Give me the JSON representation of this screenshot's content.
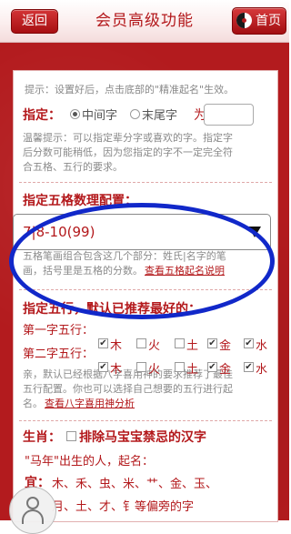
{
  "header": {
    "back": "返回",
    "title": "会员高级功能",
    "home": "首页"
  },
  "tip": "提示：设置好后，点击底部的\"精准起名\"生效。",
  "designate": {
    "label": "指定：",
    "opt_mid": "中间字",
    "opt_end": "末尾字",
    "selected": "中间字",
    "as_word": "为",
    "value": "",
    "hint_lines": [
      "温馨提示：可以指定辈分字或喜欢的字。指定字",
      "后分数可能稍低，因为您指定的字不一定完全符",
      "合五格、五行的要求。"
    ]
  },
  "wuge": {
    "heading": "指定五格数理配置：",
    "selected": "7|8-10(99)",
    "hint_lines": [
      "五格笔画组合包含这几个部分：姓氏|名字的笔",
      "画，括号里是五格的分数。"
    ],
    "link": "查看五格起名说明"
  },
  "wuxing": {
    "heading": "指定五行，默认已推荐最好的：",
    "rows": [
      {
        "label": "第一字五行：",
        "items": [
          {
            "name": "木",
            "checked": true
          },
          {
            "name": "火",
            "checked": false
          },
          {
            "name": "土",
            "checked": false
          },
          {
            "name": "金",
            "checked": true
          },
          {
            "name": "水",
            "checked": true
          }
        ]
      },
      {
        "label": "第二字五行：",
        "items": [
          {
            "name": "木",
            "checked": true
          },
          {
            "name": "火",
            "checked": false
          },
          {
            "name": "土",
            "checked": false
          },
          {
            "name": "金",
            "checked": true
          },
          {
            "name": "水",
            "checked": true
          }
        ]
      }
    ],
    "hint_lines": [
      "亲，默认已经根据八字喜用神的要求推荐了最佳",
      "五行配置。你也可以选择自己想要的五行进行起"
    ],
    "hint_tail": "名。",
    "link": "查看八字喜用神分析"
  },
  "zodiac": {
    "label": "生肖：",
    "exclude": "排除马宝宝禁忌的汉字",
    "line": "\"马年\"出生的人，起名：",
    "good_label": "宜：",
    "good_line1": "木、禾、虫、米、艹、金、玉、",
    "good_line2": "月、土、才、钅等偏旁的字"
  },
  "colors": {
    "brand_red": "#b3181b",
    "oval_blue": "#1128c9"
  }
}
